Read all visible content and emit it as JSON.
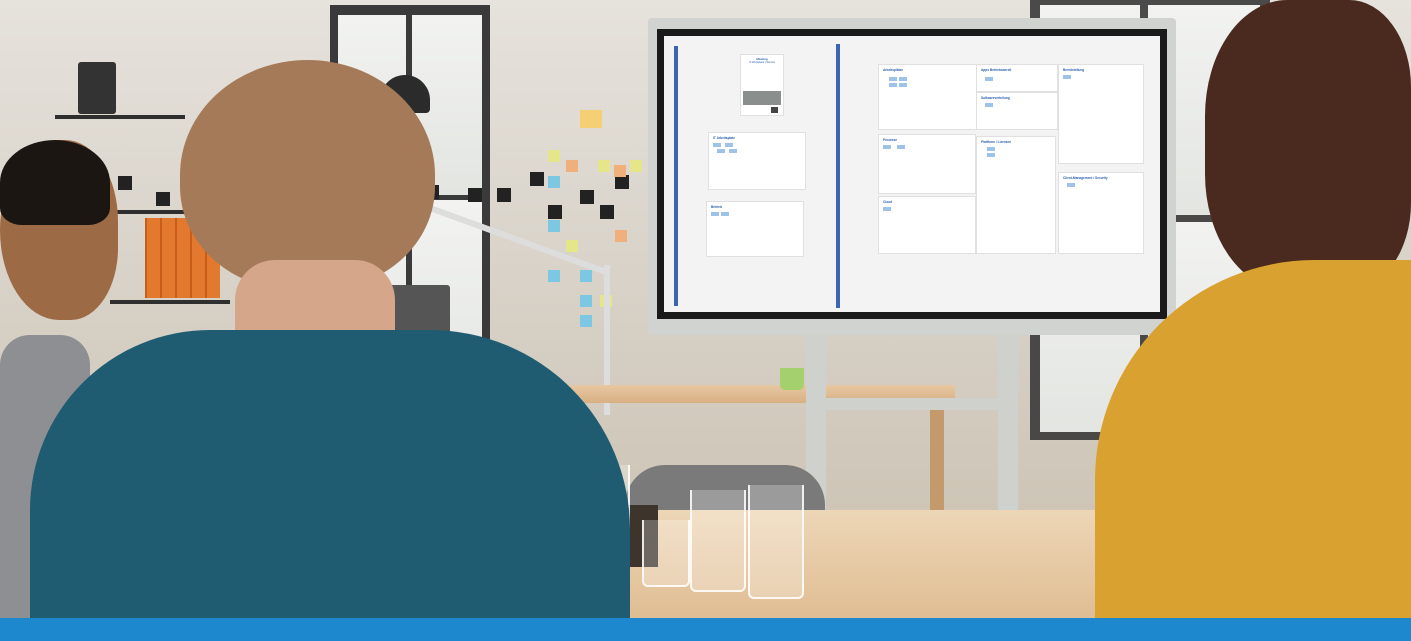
{
  "scene": {
    "description_colors": {
      "accent": "#1e88cf",
      "board_line": "#3a66b0",
      "sweater_yellow": "#d9a12f",
      "shirt_teal": "#1f5c72"
    }
  },
  "whiteboard": {
    "poster": {
      "title_line1": "Meeting",
      "title_line2": "IT-Workplace | Service"
    },
    "sections": [
      {
        "icon": "desk-icon",
        "label": "IT Arbeitsplatz"
      },
      {
        "icon": "gear-icon",
        "label": "Betrieb"
      },
      {
        "icon": "server-icon",
        "label": "Arbeitsplätze"
      },
      {
        "icon": "gear-icon",
        "label": "Apps Betriebsbereit"
      },
      {
        "icon": "person-icon",
        "label": "Bereitstellung"
      },
      {
        "icon": "gear-icon",
        "label": "Softwareverteilung"
      },
      {
        "icon": "folder-icon",
        "label": "Prozesse"
      },
      {
        "icon": "folder-icon",
        "label": "Plattform / Lizenzen"
      },
      {
        "icon": "cloud-icon",
        "label": "Cloud"
      },
      {
        "icon": "tools-icon",
        "label": "Client-Management / Security"
      }
    ]
  }
}
